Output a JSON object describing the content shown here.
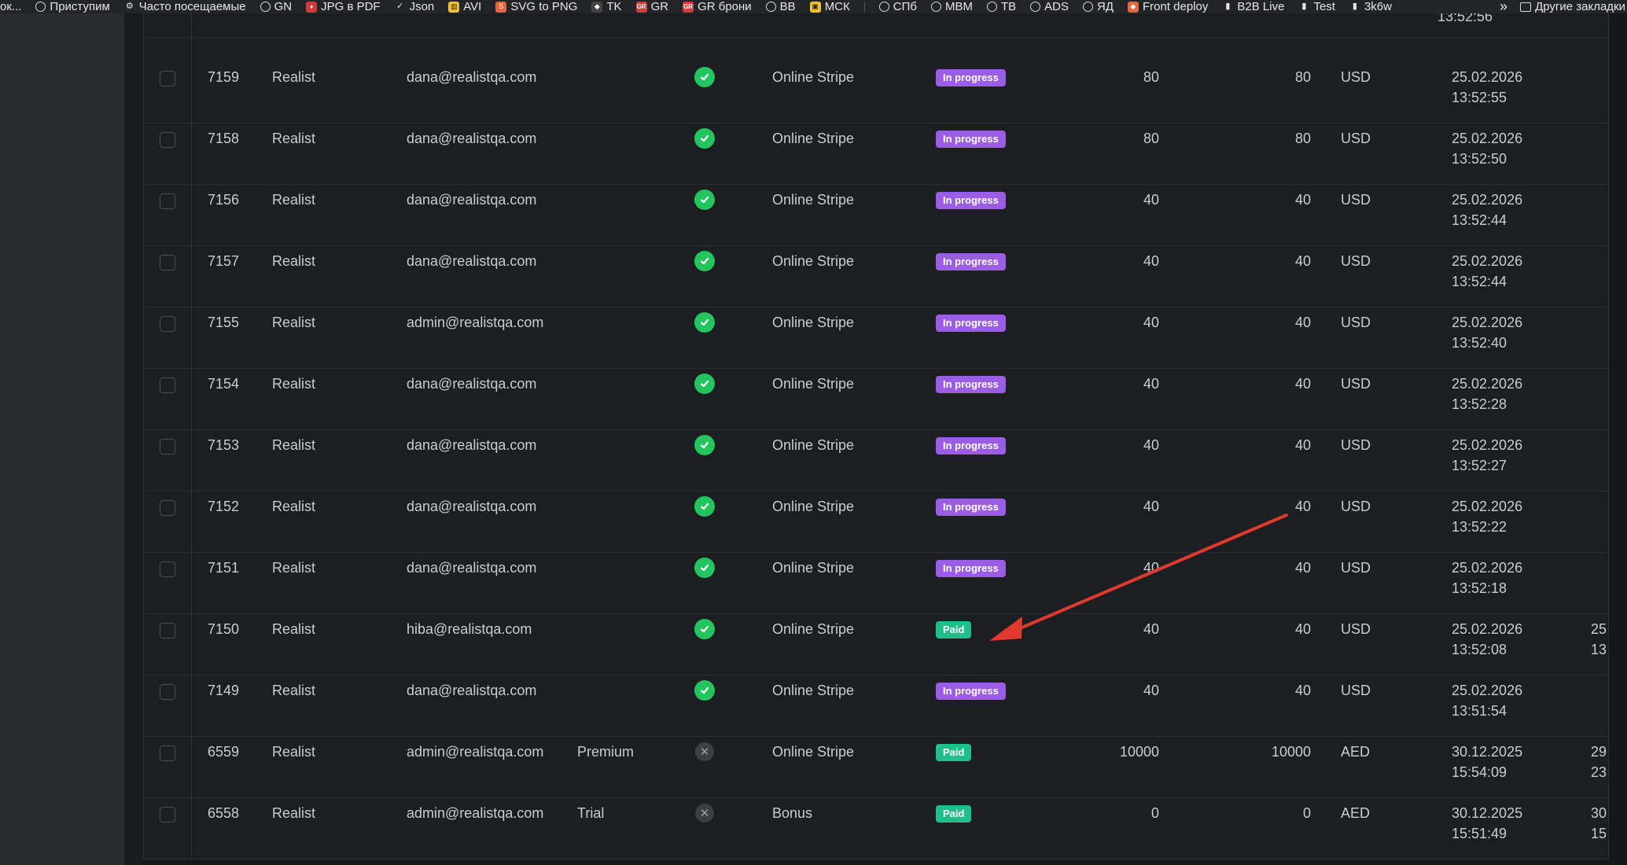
{
  "bookmarks": {
    "items": [
      {
        "label": "ок...",
        "icon": "none"
      },
      {
        "label": "Приступим",
        "icon": "globe-icon"
      },
      {
        "label": "Часто посещаемые",
        "icon": "gear-icon"
      },
      {
        "label": "GN",
        "icon": "globe-icon"
      },
      {
        "label": "JPG в PDF",
        "icon": "pdf-icon"
      },
      {
        "label": "Json",
        "icon": "check-icon"
      },
      {
        "label": "AVI",
        "icon": "chart-icon"
      },
      {
        "label": "SVG to PNG",
        "icon": "svg-icon"
      },
      {
        "label": "TK",
        "icon": "github-icon"
      },
      {
        "label": "GR",
        "icon": "gr-icon"
      },
      {
        "label": "GR брони",
        "icon": "gr-icon"
      },
      {
        "label": "BB",
        "icon": "globe-icon"
      },
      {
        "label": "МСК",
        "icon": "yellow-icon"
      },
      {
        "label": "СПб",
        "icon": "globe-icon"
      },
      {
        "label": "MBM",
        "icon": "globe-icon"
      },
      {
        "label": "TB",
        "icon": "globe-icon"
      },
      {
        "label": "ADS",
        "icon": "globe-icon"
      },
      {
        "label": "ЯД",
        "icon": "globe-icon"
      },
      {
        "label": "Front deploy",
        "icon": "gitlab-icon"
      },
      {
        "label": "B2B Live",
        "icon": "pin-icon"
      },
      {
        "label": "Test",
        "icon": "pin-icon"
      },
      {
        "label": "3k6w",
        "icon": "pin-icon"
      }
    ],
    "overflow_label": "»",
    "other_label": "Другие закладки"
  },
  "table": {
    "top_partial": {
      "time": "13:52:56"
    },
    "rows": [
      {
        "id": "7159",
        "project": "Realist",
        "email": "dana@realistqa.com",
        "plan": "",
        "active": true,
        "method": "Online Stripe",
        "status": "In progress",
        "status_type": "progress",
        "amount": "80",
        "total": "80",
        "currency": "USD",
        "date": "25.02.2026",
        "time": "13:52:55",
        "extra_date": "",
        "extra_time": ""
      },
      {
        "id": "7158",
        "project": "Realist",
        "email": "dana@realistqa.com",
        "plan": "",
        "active": true,
        "method": "Online Stripe",
        "status": "In progress",
        "status_type": "progress",
        "amount": "80",
        "total": "80",
        "currency": "USD",
        "date": "25.02.2026",
        "time": "13:52:50",
        "extra_date": "",
        "extra_time": ""
      },
      {
        "id": "7156",
        "project": "Realist",
        "email": "dana@realistqa.com",
        "plan": "",
        "active": true,
        "method": "Online Stripe",
        "status": "In progress",
        "status_type": "progress",
        "amount": "40",
        "total": "40",
        "currency": "USD",
        "date": "25.02.2026",
        "time": "13:52:44",
        "extra_date": "",
        "extra_time": ""
      },
      {
        "id": "7157",
        "project": "Realist",
        "email": "dana@realistqa.com",
        "plan": "",
        "active": true,
        "method": "Online Stripe",
        "status": "In progress",
        "status_type": "progress",
        "amount": "40",
        "total": "40",
        "currency": "USD",
        "date": "25.02.2026",
        "time": "13:52:44",
        "extra_date": "",
        "extra_time": ""
      },
      {
        "id": "7155",
        "project": "Realist",
        "email": "admin@realistqa.com",
        "plan": "",
        "active": true,
        "method": "Online Stripe",
        "status": "In progress",
        "status_type": "progress",
        "amount": "40",
        "total": "40",
        "currency": "USD",
        "date": "25.02.2026",
        "time": "13:52:40",
        "extra_date": "",
        "extra_time": ""
      },
      {
        "id": "7154",
        "project": "Realist",
        "email": "dana@realistqa.com",
        "plan": "",
        "active": true,
        "method": "Online Stripe",
        "status": "In progress",
        "status_type": "progress",
        "amount": "40",
        "total": "40",
        "currency": "USD",
        "date": "25.02.2026",
        "time": "13:52:28",
        "extra_date": "",
        "extra_time": ""
      },
      {
        "id": "7153",
        "project": "Realist",
        "email": "dana@realistqa.com",
        "plan": "",
        "active": true,
        "method": "Online Stripe",
        "status": "In progress",
        "status_type": "progress",
        "amount": "40",
        "total": "40",
        "currency": "USD",
        "date": "25.02.2026",
        "time": "13:52:27",
        "extra_date": "",
        "extra_time": ""
      },
      {
        "id": "7152",
        "project": "Realist",
        "email": "dana@realistqa.com",
        "plan": "",
        "active": true,
        "method": "Online Stripe",
        "status": "In progress",
        "status_type": "progress",
        "amount": "40",
        "total": "40",
        "currency": "USD",
        "date": "25.02.2026",
        "time": "13:52:22",
        "extra_date": "",
        "extra_time": ""
      },
      {
        "id": "7151",
        "project": "Realist",
        "email": "dana@realistqa.com",
        "plan": "",
        "active": true,
        "method": "Online Stripe",
        "status": "In progress",
        "status_type": "progress",
        "amount": "40",
        "total": "40",
        "currency": "USD",
        "date": "25.02.2026",
        "time": "13:52:18",
        "extra_date": "",
        "extra_time": ""
      },
      {
        "id": "7150",
        "project": "Realist",
        "email": "hiba@realistqa.com",
        "plan": "",
        "active": true,
        "method": "Online Stripe",
        "status": "Paid",
        "status_type": "paid",
        "amount": "40",
        "total": "40",
        "currency": "USD",
        "date": "25.02.2026",
        "time": "13:52:08",
        "extra_date": "25",
        "extra_time": "13"
      },
      {
        "id": "7149",
        "project": "Realist",
        "email": "dana@realistqa.com",
        "plan": "",
        "active": true,
        "method": "Online Stripe",
        "status": "In progress",
        "status_type": "progress",
        "amount": "40",
        "total": "40",
        "currency": "USD",
        "date": "25.02.2026",
        "time": "13:51:54",
        "extra_date": "",
        "extra_time": ""
      },
      {
        "id": "6559",
        "project": "Realist",
        "email": "admin@realistqa.com",
        "plan": "Premium",
        "active": false,
        "method": "Online Stripe",
        "status": "Paid",
        "status_type": "paid",
        "amount": "10000",
        "total": "10000",
        "currency": "AED",
        "date": "30.12.2025",
        "time": "15:54:09",
        "extra_date": "29",
        "extra_time": "23"
      },
      {
        "id": "6558",
        "project": "Realist",
        "email": "admin@realistqa.com",
        "plan": "Trial",
        "active": false,
        "method": "Bonus",
        "status": "Paid",
        "status_type": "paid",
        "amount": "0",
        "total": "0",
        "currency": "AED",
        "date": "30.12.2025",
        "time": "15:51:49",
        "extra_date": "30",
        "extra_time": "15"
      }
    ]
  },
  "colors": {
    "background": "#16171a",
    "table_bg": "#1d1e22",
    "progress_badge": "#9b5de5",
    "paid_badge": "#1fbf8a",
    "active_icon": "#22c55e",
    "annotation_arrow": "#e03a2f"
  }
}
